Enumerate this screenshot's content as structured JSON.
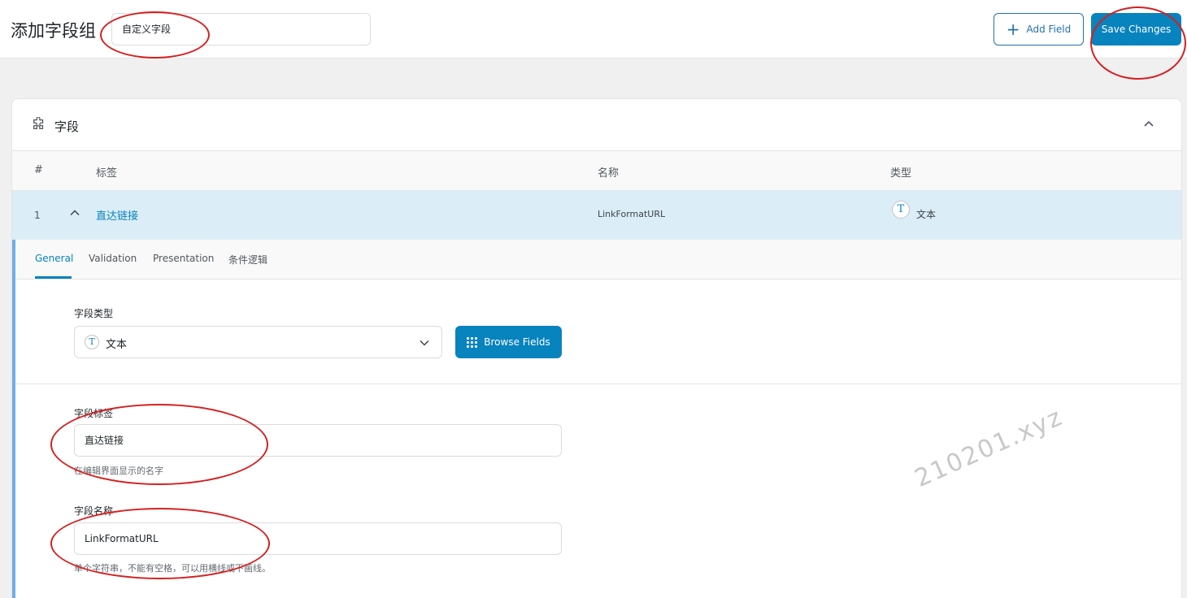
{
  "header": {
    "title": "添加字段组",
    "group_title_value": "自定义字段",
    "add_field_label": "Add Field",
    "save_label": "Save Changes"
  },
  "panel": {
    "title": "字段",
    "columns": {
      "num": "#",
      "label": "标签",
      "name": "名称",
      "type": "类型"
    },
    "row": {
      "num": "1",
      "label": "直达链接",
      "name": "LinkFormatURL",
      "type_icon": "T",
      "type": "文本"
    }
  },
  "tabs": [
    "General",
    "Validation",
    "Presentation",
    "条件逻辑"
  ],
  "form": {
    "field_type_label": "字段类型",
    "field_type_icon": "T",
    "field_type_value": "文本",
    "browse_label": "Browse Fields",
    "field_label_label": "字段标签",
    "field_label_value": "直达链接",
    "field_label_hint": "在编辑界面显示的名字",
    "field_name_label": "字段名称",
    "field_name_value": "LinkFormatURL",
    "field_name_hint": "单个字符串，不能有空格，可以用横线或下画线。"
  },
  "watermark": "210201.xyz",
  "colors": {
    "accent": "#0783be",
    "annotation": "#d61f1f",
    "row_highlight": "#dbedf6"
  }
}
